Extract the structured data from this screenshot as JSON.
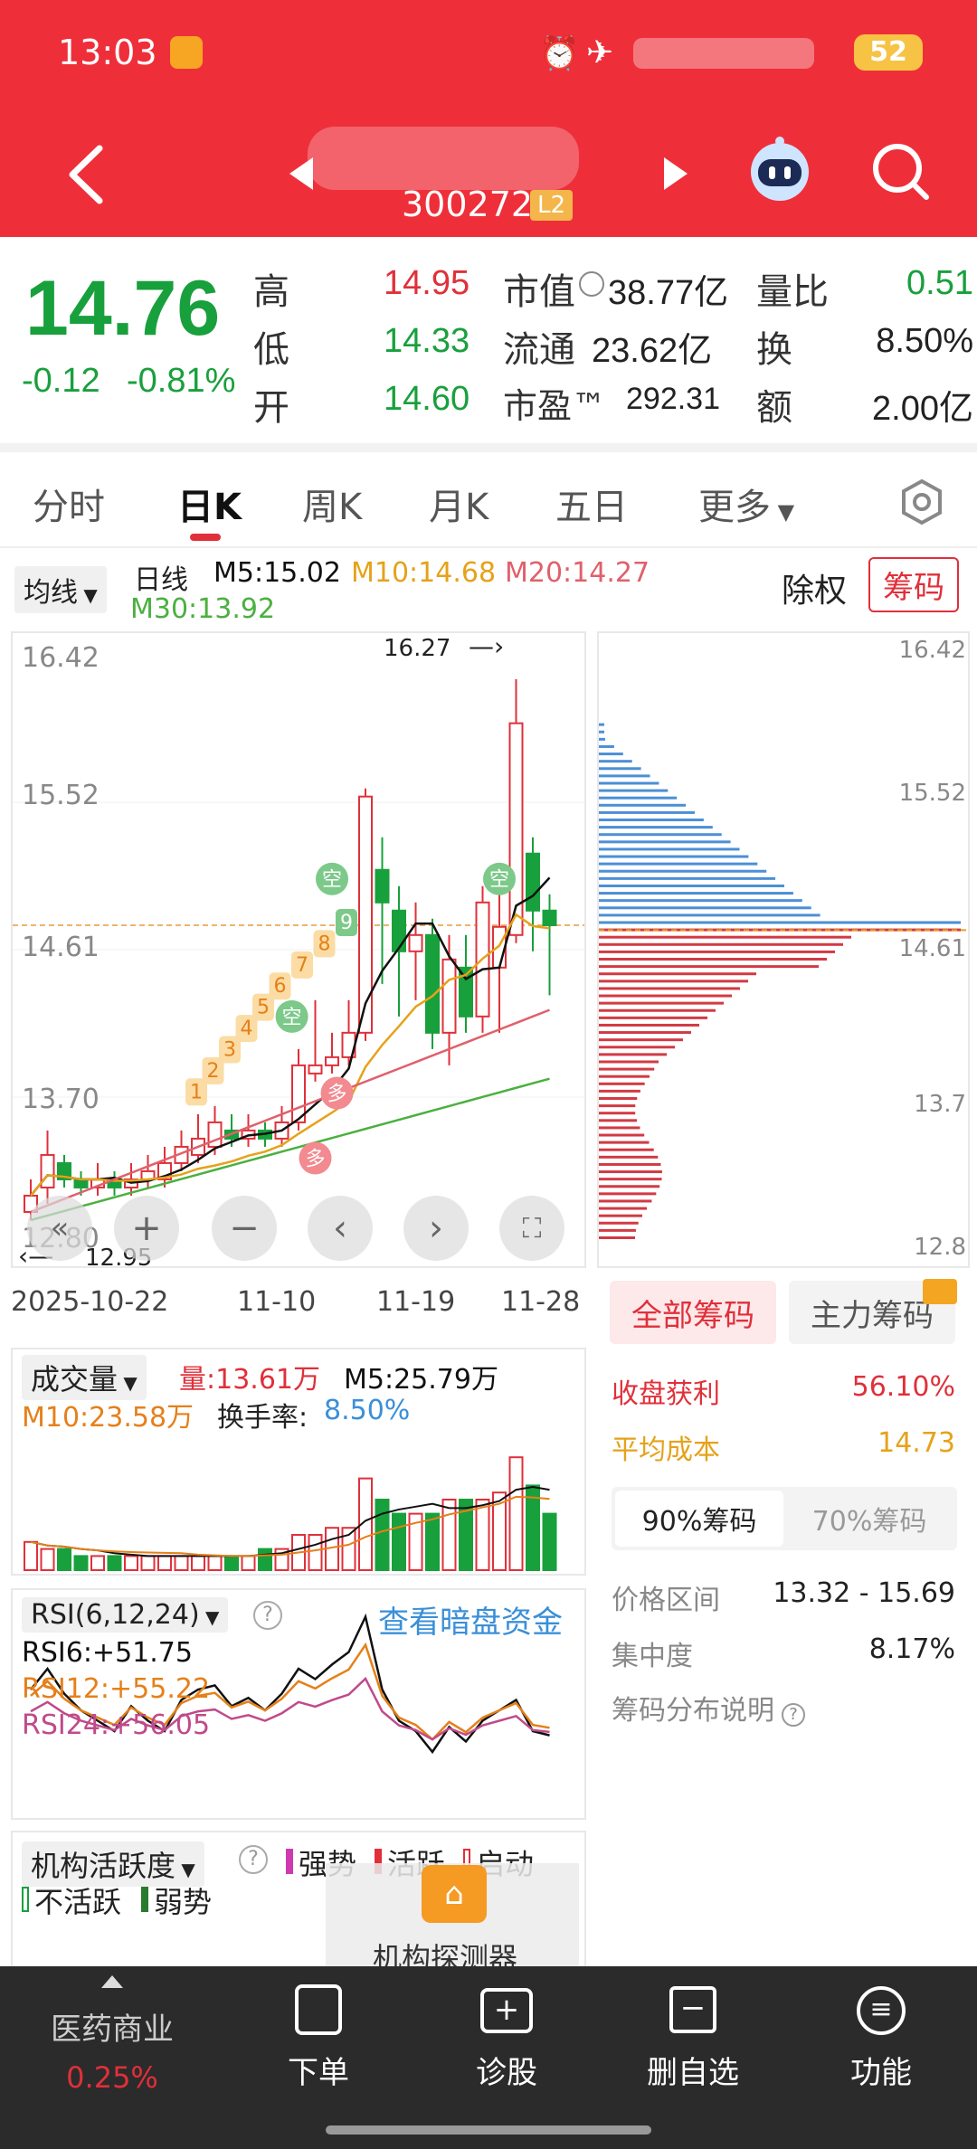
{
  "status_bar": {
    "time": "13:03",
    "battery": "52"
  },
  "header": {
    "stock_code": "300272",
    "level_badge": "L2"
  },
  "quote": {
    "price": "14.76",
    "change": "-0.12",
    "change_pct": "-0.81%",
    "high_label": "高",
    "high": "14.95",
    "low_label": "低",
    "low": "14.33",
    "open_label": "开",
    "open": "14.60",
    "mktcap_label": "市值",
    "mktcap": "38.77亿",
    "float_label": "流通",
    "float": "23.62亿",
    "pe_label": "市盈™",
    "pe": "292.31",
    "volratio_label": "量比",
    "volratio": "0.51",
    "turnover_label": "换",
    "turnover": "8.50%",
    "amount_label": "额",
    "amount": "2.00亿"
  },
  "tabs": [
    "分时",
    "日K",
    "周K",
    "月K",
    "五日",
    "更多"
  ],
  "indicators": {
    "ma_select": "均线",
    "period": "日线",
    "m5": "M5:15.02",
    "m10": "M10:14.68",
    "m20": "M20:14.27",
    "m30": "M30:13.92",
    "exright": "除权",
    "chips_btn": "筹码"
  },
  "kline": {
    "y_ticks": [
      "16.42",
      "15.52",
      "14.61",
      "13.70",
      "12.80"
    ],
    "x_ticks": [
      "2025-10-22",
      "11-10",
      "11-19",
      "11-28"
    ],
    "max_label": "16.27",
    "min_label": "12.95",
    "countdown": [
      "1",
      "2",
      "3",
      "4",
      "5",
      "6",
      "7",
      "8",
      "9"
    ],
    "badge_kong": "空",
    "badge_duo": "多"
  },
  "chips": {
    "y_ticks": [
      "16.42",
      "15.52",
      "14.61",
      "13.7",
      "12.8"
    ],
    "tab_all": "全部筹码",
    "tab_main": "主力筹码",
    "profit_label": "收盘获利",
    "profit": "56.10%",
    "avgcost_label": "平均成本",
    "avgcost": "14.73",
    "sub_tab_90": "90%筹码",
    "sub_tab_70": "70%筹码",
    "range_label": "价格区间",
    "range": "13.32 - 15.69",
    "conc_label": "集中度",
    "conc": "8.17%",
    "explain": "筹码分布说明"
  },
  "volume": {
    "select": "成交量",
    "vol": "量:13.61万",
    "m5": "M5:25.79万",
    "m10": "M10:23.58万",
    "turnover_label": "换手率:",
    "turnover": "8.50%"
  },
  "rsi": {
    "select": "RSI(6,12,24)",
    "link": "查看暗盘资金",
    "rsi6": "RSI6:+51.75",
    "rsi12": "RSI12:+55.22",
    "rsi24": "RSI24:+56.05"
  },
  "institution": {
    "select": "机构活跃度",
    "strong": "强势",
    "active": "活跃",
    "start": "启动",
    "inactive": "不活跃",
    "weak": "弱势",
    "detector": "机构探测器"
  },
  "nav": {
    "sector": "医药商业",
    "sector_pct": "0.25%",
    "order": "下单",
    "diagnose": "诊股",
    "remove": "删自选",
    "func": "功能"
  },
  "colors": {
    "header": "#ee2f3a",
    "up": "#e0303a",
    "down": "#18a03c",
    "m5": "#111111",
    "m10": "#e5a21a",
    "m20": "#e0606a",
    "m30": "#4bb040",
    "chip_profit": "#d23a44",
    "chip_loss": "#4b8fd6"
  }
}
